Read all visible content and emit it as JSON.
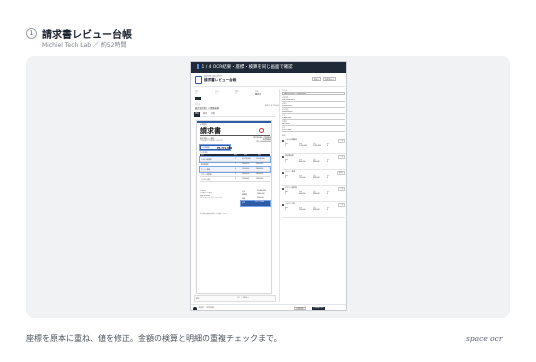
{
  "header": {
    "step": "1",
    "title": "請求書レビュー台帳",
    "subtitle": "Michiel Tech Lab ／ 約52時間"
  },
  "screen": {
    "titlebar": "1 / 4  OCR結果・座標・検算を同じ画面で確認",
    "app": {
      "label": "ROUTE PROJECT",
      "title": "請求書レビュー台帳",
      "buttons": [
        "差戻し",
        "承認待ちへ"
      ]
    },
    "meta": [
      {
        "k": "受付",
        "v": "—"
      },
      {
        "k": "担当",
        "v": "—"
      },
      {
        "k": "期限",
        "v": "—"
      },
      {
        "k": "状態",
        "v": "確認中"
      }
    ],
    "vendor": {
      "k": "取引先",
      "v": "株式会社新しい開発技術",
      "right": "合計 ¥ 3,771,000"
    },
    "tabs": [
      "原本",
      "抽出",
      "比較"
    ],
    "document": {
      "small": "請求番号",
      "title": "請求書",
      "to": "株式会社○○ 御中",
      "to_sub": "下記の通りご請求申し上げます。",
      "from": [
        "株式会社新しい開発技術",
        "東京都港区",
        "TEL 03-0000-0000"
      ],
      "total_label": "ご請求金額",
      "total_value": "¥3,771,000",
      "due": "お支払期限",
      "columns": [
        "品目",
        "数量",
        "単価",
        "金額"
      ],
      "rows": [
        {
          "item": "システム開発費",
          "qty": "1",
          "price": "¥1,200,000",
          "amount": "¥1,200,000"
        },
        {
          "item": "保守運用費",
          "qty": "1",
          "price": "¥800,000",
          "amount": "¥800,000"
        },
        {
          "item": "サーバー費用",
          "qty": "3",
          "price": "¥150,000",
          "amount": "¥450,000"
        },
        {
          "item": "デザイン制作費",
          "qty": "1",
          "price": "¥600,000",
          "amount": "¥600,000"
        },
        {
          "item": "ライセンス料",
          "qty": "2",
          "price": "¥200,000",
          "amount": "¥400,000"
        }
      ],
      "bank": [
        "お振込先",
        "○○銀行 ○○支店",
        "普通 0000000",
        "カ）アタラシイカイハツギジュツ"
      ],
      "summary": [
        {
          "k": "小計",
          "v": "¥3,450,000"
        },
        {
          "k": "消費税",
          "v": "¥345,000"
        },
        {
          "k": "源泉",
          "v": "¥24,000"
        }
      ],
      "grand": {
        "k": "合計",
        "v": "¥3,771,000"
      },
      "note": "※ お振込手数料は貴社にてご負担ください。"
    },
    "thumbs": {
      "label": "原本",
      "controls": "1 / 1   −  100%  +"
    },
    "sidebar": {
      "heading": "取引先",
      "input": "株式会社新しい開発技術",
      "fields": [
        {
          "k": "請求番号",
          "v": "INV-2024-0312"
        },
        {
          "k": "請求日",
          "v": "2024/03/12"
        },
        {
          "k": "支払期限",
          "v": "2024/04/30"
        },
        {
          "k": "小計",
          "v": "3,450,000"
        },
        {
          "k": "消費税",
          "v": "345,000"
        },
        {
          "k": "合計",
          "v": "3,771,000"
        }
      ],
      "line_head": "明細",
      "line_cols": [
        "数量",
        "単価",
        "金額",
        "差分"
      ],
      "lines": [
        {
          "n": "1",
          "name": "システム開発費",
          "chip": "一致",
          "vals": [
            "1",
            "1,200,000",
            "1,200,000",
            "0"
          ]
        },
        {
          "n": "2",
          "name": "保守運用費",
          "chip": "一致",
          "vals": [
            "1",
            "800,000",
            "800,000",
            "0"
          ]
        },
        {
          "n": "3",
          "name": "サーバー費用",
          "chip": "要確認",
          "vals": [
            "3",
            "150,000",
            "450,000",
            "0"
          ]
        },
        {
          "n": "4",
          "name": "デザイン制作費",
          "chip": "重複",
          "vals": [
            "1",
            "600,000",
            "600,000",
            "0"
          ]
        },
        {
          "n": "5",
          "name": "ライセンス料",
          "chip": "一致",
          "vals": [
            "2",
            "200,000",
            "400,000",
            "0"
          ]
        }
      ]
    },
    "footer": {
      "text": "確認者 ・ 3件の指摘",
      "buttons": [
        "下書き保存",
        "承認依頼を送信"
      ]
    }
  },
  "caption": "座標を原本に重ね、値を修正。金額の検算と明細の重複チェックまで。",
  "brand": "space ocr",
  "colors": {
    "dark": "#1f2937",
    "accent": "#2f5aa8",
    "card": "#f1f2f4"
  }
}
